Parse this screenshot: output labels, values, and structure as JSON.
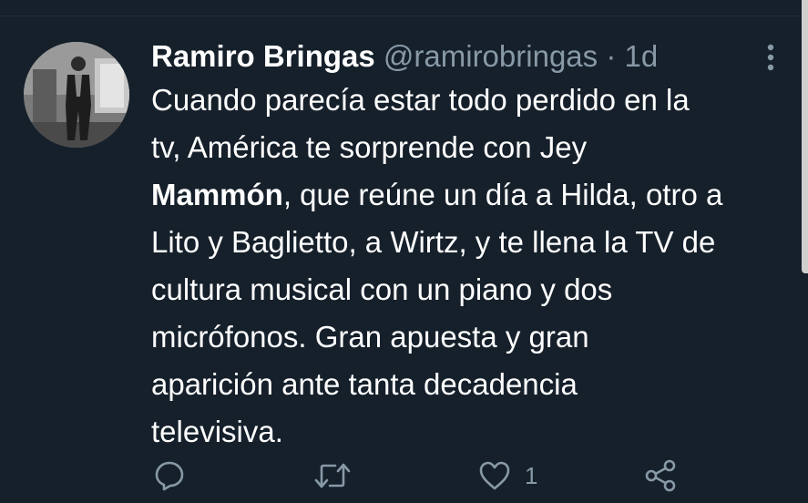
{
  "tweet": {
    "author_name": "Ramiro Bringas",
    "handle": "@ramirobringas",
    "separator": "·",
    "time": "1d",
    "text_lines": [
      {
        "pre": "Cuando parecía estar todo perdido en la",
        "bold": "",
        "post": ""
      },
      {
        "pre": "tv, América te sorprende con Jey",
        "bold": "",
        "post": ""
      },
      {
        "pre": "",
        "bold": "Mammón",
        "post": ", que reúne un día a Hilda, otro a"
      },
      {
        "pre": "Lito y Baglietto, a Wirtz, y te llena la TV de",
        "bold": "",
        "post": ""
      },
      {
        "pre": "cultura musical con un piano y dos",
        "bold": "",
        "post": ""
      },
      {
        "pre": "micrófonos. Gran apuesta y gran",
        "bold": "",
        "post": ""
      },
      {
        "pre": "aparición ante tanta decadencia",
        "bold": "",
        "post": ""
      },
      {
        "pre": "televisiva.",
        "bold": "",
        "post": ""
      }
    ],
    "like_count": "1"
  },
  "icons": {
    "more": "more-vertical-icon",
    "reply": "reply-icon",
    "retweet": "retweet-icon",
    "like": "heart-icon",
    "share": "share-icon"
  },
  "colors": {
    "background": "#15202b",
    "text": "#ffffff",
    "secondary": "#8899a6"
  }
}
